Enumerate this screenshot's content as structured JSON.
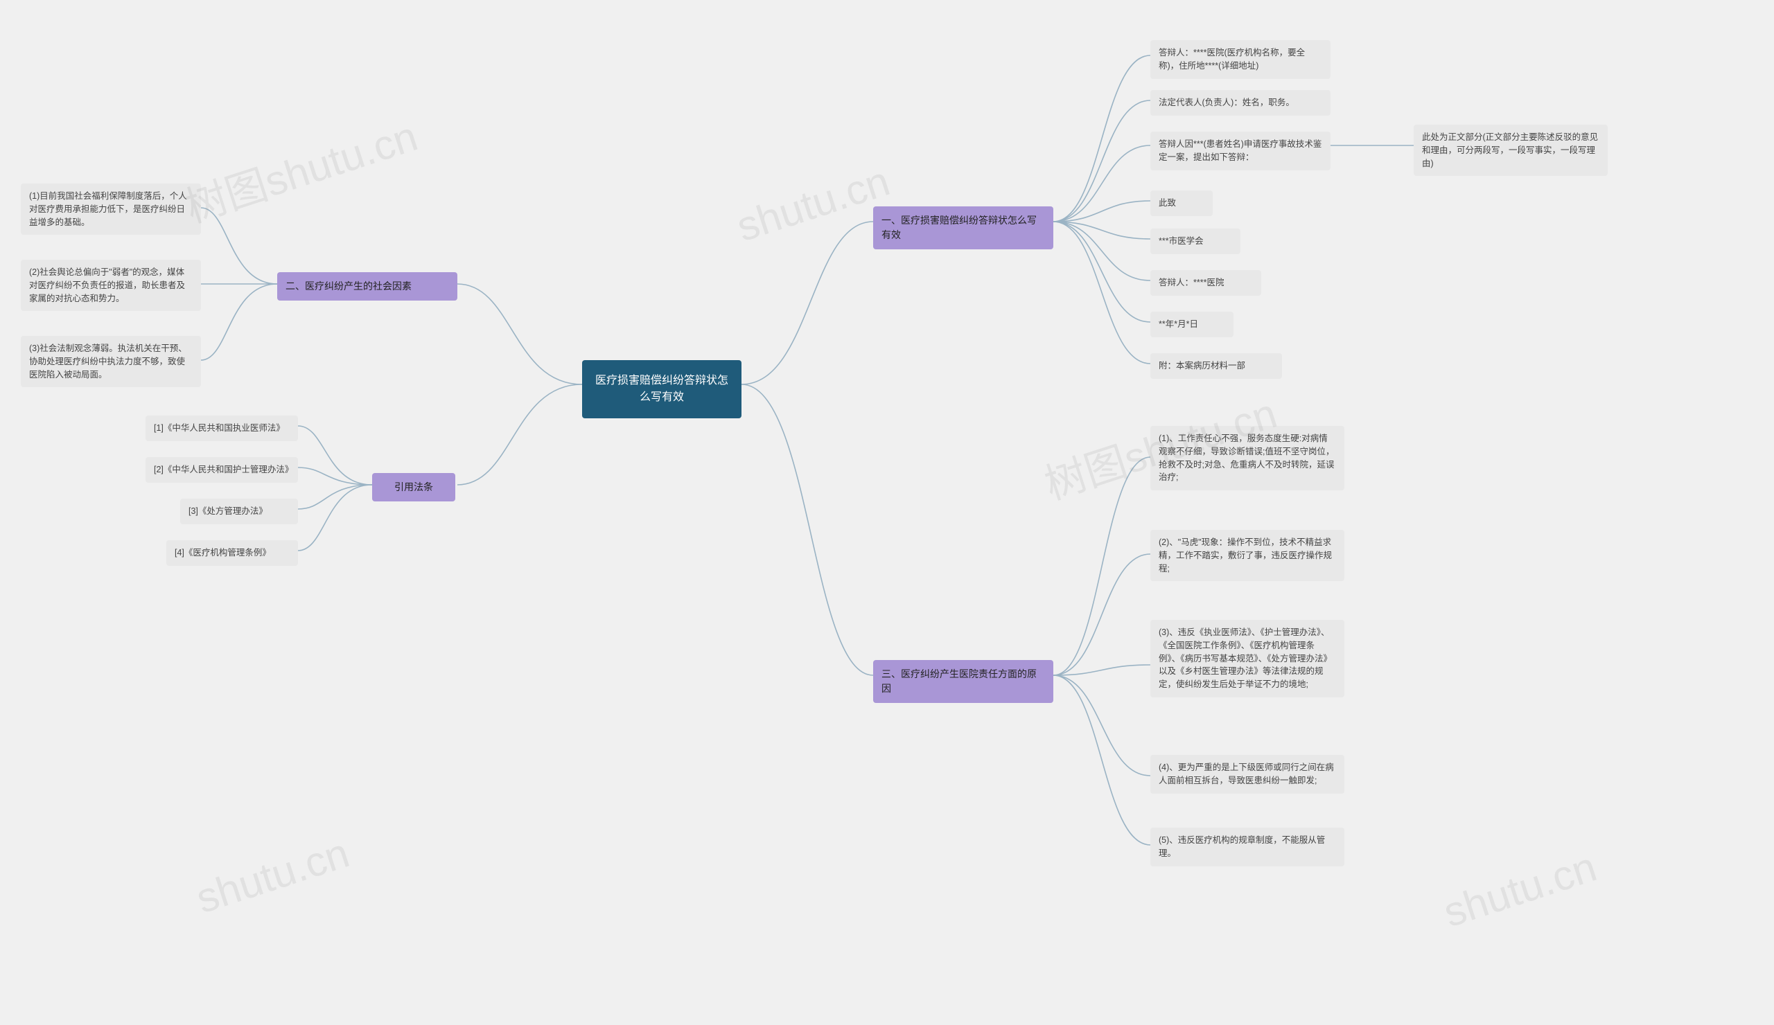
{
  "root": "医疗损害赔偿纠纷答辩状怎么写有效",
  "branches": {
    "b1": "一、医疗损害赔偿纠纷答辩状怎么写有效",
    "b2": "二、医疗纠纷产生的社会因素",
    "b3": "三、医疗纠纷产生医院责任方面的原因",
    "b4": "引用法条"
  },
  "b1_children": {
    "c1": "答辩人：****医院(医疗机构名称，要全称)，住所地****(详细地址)",
    "c2": "法定代表人(负责人)：姓名，职务。",
    "c3": "答辩人因***(患者姓名)申请医疗事故技术鉴定一案，提出如下答辩：",
    "c3_sub": "此处为正文部分(正文部分主要陈述反驳的意见和理由，可分两段写，一段写事实，一段写理由)",
    "c4": "此致",
    "c5": "***市医学会",
    "c6": "答辩人：****医院",
    "c7": "**年*月*日",
    "c8": "附：本案病历材料一部"
  },
  "b2_children": {
    "c1": "(1)目前我国社会福利保障制度落后，个人对医疗费用承担能力低下，是医疗纠纷日益增多的基础。",
    "c2": "(2)社会舆论总偏向于\"弱者\"的观念，媒体对医疗纠纷不负责任的报道，助长患者及家属的对抗心态和势力。",
    "c3": "(3)社会法制观念薄弱。执法机关在干预、协助处理医疗纠纷中执法力度不够，致使医院陷入被动局面。"
  },
  "b3_children": {
    "c1": "(1)、工作责任心不强，服务态度生硬:对病情观察不仔细，导致诊断错误;值班不坚守岗位，抢救不及时;对急、危重病人不及时转院，延误治疗;",
    "c2": "(2)、\"马虎\"现象：操作不到位，技术不精益求精，工作不踏实，敷衍了事，违反医疗操作规程;",
    "c3": "(3)、违反《执业医师法》、《护士管理办法》、《全国医院工作条例》、《医疗机构管理条例》、《病历书写基本规范》、《处方管理办法》以及《乡村医生管理办法》等法律法规的规定，使纠纷发生后处于举证不力的境地;",
    "c4": "(4)、更为严重的是上下级医师或同行之间在病人面前相互拆台，导致医患纠纷一触即发;",
    "c5": "(5)、违反医疗机构的规章制度，不能服从管理。"
  },
  "b4_children": {
    "c1": "[1]《中华人民共和国执业医师法》",
    "c2": "[2]《中华人民共和国护士管理办法》",
    "c3": "[3]《处方管理办法》",
    "c4": "[4]《医疗机构管理条例》"
  },
  "watermarks": [
    "树图shutu.cn",
    "shutu.cn",
    "shutu.cn",
    "树图shutu.cn",
    "shutu.cn"
  ]
}
